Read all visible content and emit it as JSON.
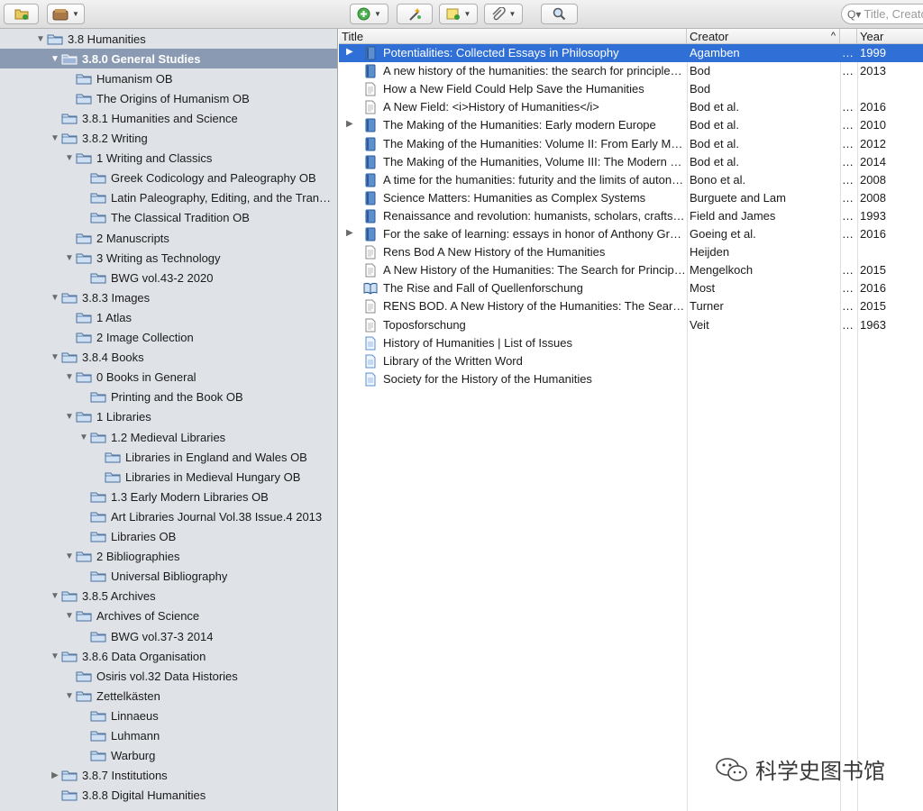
{
  "toolbar": {
    "search_placeholder": "Title, Creator"
  },
  "sidebar": {
    "items": [
      {
        "label": "3.8 Humanities",
        "level": 2,
        "disclosure": "open"
      },
      {
        "label": "3.8.0 General Studies",
        "level": 3,
        "disclosure": "open",
        "selected": true
      },
      {
        "label": "Humanism OB",
        "level": 4,
        "disclosure": "none"
      },
      {
        "label": "The Origins of Humanism OB",
        "level": 4,
        "disclosure": "none"
      },
      {
        "label": "3.8.1 Humanities and Science",
        "level": 3,
        "disclosure": "none"
      },
      {
        "label": "3.8.2 Writing",
        "level": 3,
        "disclosure": "open"
      },
      {
        "label": "1 Writing and Classics",
        "level": 4,
        "disclosure": "open"
      },
      {
        "label": "Greek Codicology and Paleography OB",
        "level": 5,
        "disclosure": "none"
      },
      {
        "label": "Latin Paleography, Editing, and the Transmission of Texts OB",
        "level": 5,
        "disclosure": "none"
      },
      {
        "label": "The Classical Tradition OB",
        "level": 5,
        "disclosure": "none"
      },
      {
        "label": "2 Manuscripts",
        "level": 4,
        "disclosure": "none"
      },
      {
        "label": "3 Writing as Technology",
        "level": 4,
        "disclosure": "open"
      },
      {
        "label": "BWG vol.43-2 2020",
        "level": 5,
        "disclosure": "none"
      },
      {
        "label": "3.8.3 Images",
        "level": 3,
        "disclosure": "open"
      },
      {
        "label": "1 Atlas",
        "level": 4,
        "disclosure": "none"
      },
      {
        "label": "2 Image Collection",
        "level": 4,
        "disclosure": "none"
      },
      {
        "label": "3.8.4 Books",
        "level": 3,
        "disclosure": "open"
      },
      {
        "label": "0 Books in General",
        "level": 4,
        "disclosure": "open"
      },
      {
        "label": "Printing and the Book OB",
        "level": 5,
        "disclosure": "none"
      },
      {
        "label": "1 Libraries",
        "level": 4,
        "disclosure": "open"
      },
      {
        "label": "1.2 Medieval Libraries",
        "level": 5,
        "disclosure": "open"
      },
      {
        "label": "Libraries in England and Wales OB",
        "level": 6,
        "disclosure": "none"
      },
      {
        "label": "Libraries in Medieval Hungary OB",
        "level": 6,
        "disclosure": "none"
      },
      {
        "label": "1.3 Early Modern Libraries OB",
        "level": 5,
        "disclosure": "none"
      },
      {
        "label": "Art Libraries Journal Vol.38 Issue.4 2013",
        "level": 5,
        "disclosure": "none"
      },
      {
        "label": "Libraries OB",
        "level": 5,
        "disclosure": "none"
      },
      {
        "label": "2 Bibliographies",
        "level": 4,
        "disclosure": "open"
      },
      {
        "label": "Universal Bibliography",
        "level": 5,
        "disclosure": "none"
      },
      {
        "label": "3.8.5 Archives",
        "level": 3,
        "disclosure": "open"
      },
      {
        "label": "Archives of Science",
        "level": 4,
        "disclosure": "open"
      },
      {
        "label": "BWG vol.37-3 2014",
        "level": 5,
        "disclosure": "none"
      },
      {
        "label": "3.8.6 Data Organisation",
        "level": 3,
        "disclosure": "open"
      },
      {
        "label": "Osiris vol.32 Data Histories",
        "level": 4,
        "disclosure": "none"
      },
      {
        "label": "Zettelkästen",
        "level": 4,
        "disclosure": "open"
      },
      {
        "label": "Linnaeus",
        "level": 5,
        "disclosure": "none"
      },
      {
        "label": "Luhmann",
        "level": 5,
        "disclosure": "none"
      },
      {
        "label": "Warburg",
        "level": 5,
        "disclosure": "none"
      },
      {
        "label": "3.8.7 Institutions",
        "level": 3,
        "disclosure": "closed"
      },
      {
        "label": "3.8.8 Digital Humanities",
        "level": 3,
        "disclosure": "none"
      }
    ]
  },
  "table": {
    "columns": {
      "title": "Title",
      "creator": "Creator",
      "year": "Year"
    },
    "sort_indicator": "^",
    "rows": [
      {
        "title": "Potentialities: Collected Essays in Philosophy",
        "creator": "Agamben",
        "dots": "…",
        "year": "1999",
        "icon": "book-icon",
        "twisty": "▶",
        "selected": true
      },
      {
        "title": "A new history of the humanities: the search for principles and patterns from antiquity to the present",
        "creator": "Bod",
        "dots": "…",
        "year": "2013",
        "icon": "book-icon",
        "twisty": ""
      },
      {
        "title": "How a New Field Could Help Save the Humanities",
        "creator": "Bod",
        "dots": "",
        "year": "",
        "icon": "document-icon",
        "twisty": ""
      },
      {
        "title": "A New Field: <i>History of Humanities</i>",
        "creator": "Bod et al.",
        "dots": "…",
        "year": "2016",
        "icon": "document-icon",
        "twisty": ""
      },
      {
        "title": "The Making of the Humanities: Early modern Europe",
        "creator": "Bod et al.",
        "dots": "…",
        "year": "2010",
        "icon": "book-icon",
        "twisty": "▶"
      },
      {
        "title": "The Making of the Humanities: Volume II: From Early Modern to Modern Disciplines",
        "creator": "Bod et al.",
        "dots": "…",
        "year": "2012",
        "icon": "book-icon",
        "twisty": ""
      },
      {
        "title": "The Making of the Humanities, Volume III: The Modern Humanities",
        "creator": "Bod et al.",
        "dots": "…",
        "year": "2014",
        "icon": "book-icon",
        "twisty": ""
      },
      {
        "title": "A time for the humanities: futurity and the limits of autonomy",
        "creator": "Bono et al.",
        "dots": "…",
        "year": "2008",
        "icon": "book-icon",
        "twisty": ""
      },
      {
        "title": "Science Matters: Humanities as Complex Systems",
        "creator": "Burguete and Lam",
        "dots": "…",
        "year": "2008",
        "icon": "book-icon",
        "twisty": ""
      },
      {
        "title": "Renaissance and revolution: humanists, scholars, craftsmen, and natural philosophers",
        "creator": "Field and James",
        "dots": "…",
        "year": "1993",
        "icon": "book-icon",
        "twisty": ""
      },
      {
        "title": "For the sake of learning: essays in honor of Anthony Grafton",
        "creator": "Goeing et al.",
        "dots": "…",
        "year": "2016",
        "icon": "book-icon",
        "twisty": "▶"
      },
      {
        "title": "Rens Bod A New History of the Humanities",
        "creator": "Heijden",
        "dots": "",
        "year": "",
        "icon": "document-icon",
        "twisty": ""
      },
      {
        "title": "A New History of the Humanities: The Search for Principles and Patterns",
        "creator": "Mengelkoch",
        "dots": "…",
        "year": "2015",
        "icon": "document-icon",
        "twisty": ""
      },
      {
        "title": "The Rise and Fall of Quellenforschung",
        "creator": "Most",
        "dots": "…",
        "year": "2016",
        "icon": "book-section-icon",
        "twisty": ""
      },
      {
        "title": "RENS BOD. A New History of the Humanities: The Search for Principles",
        "creator": "Turner",
        "dots": "…",
        "year": "2015",
        "icon": "document-icon",
        "twisty": ""
      },
      {
        "title": "Toposforschung",
        "creator": "Veit",
        "dots": "…",
        "year": "1963",
        "icon": "document-icon",
        "twisty": ""
      },
      {
        "title": "History of Humanities | List of Issues",
        "creator": "",
        "dots": "",
        "year": "",
        "icon": "webpage-icon",
        "twisty": ""
      },
      {
        "title": "Library of the Written Word",
        "creator": "",
        "dots": "",
        "year": "",
        "icon": "webpage-icon",
        "twisty": ""
      },
      {
        "title": "Society for the History of the Humanities",
        "creator": "",
        "dots": "",
        "year": "",
        "icon": "webpage-icon",
        "twisty": ""
      }
    ]
  },
  "watermark": {
    "text": "科学史图书馆"
  },
  "colors": {
    "selection_blue": "#2f6fd6",
    "sidebar_selection": "#8a9ab2",
    "sidebar_bg": "#dfe3e8"
  }
}
